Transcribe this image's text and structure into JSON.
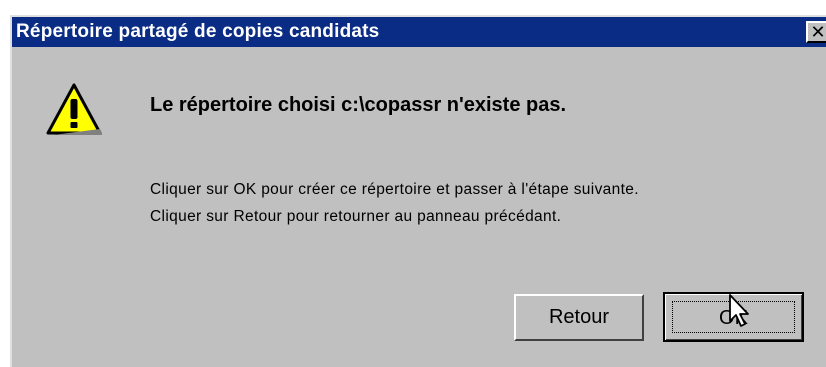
{
  "window": {
    "title": "Répertoire partagé de copies candidats",
    "close_glyph": "✕"
  },
  "message": {
    "heading": "Le répertoire choisi c:\\copassr n'existe pas.",
    "line1": "Cliquer sur OK pour créer ce répertoire et passer à l'étape suivante.",
    "line2": "Cliquer sur Retour pour retourner au panneau précédant."
  },
  "buttons": {
    "back_label": "Retour",
    "ok_label": "OK"
  },
  "icons": {
    "warning": "warning-icon",
    "close": "close-icon",
    "cursor": "mouse-pointer-icon"
  },
  "colors": {
    "titlebar": "#0a2c85",
    "dialog_bg": "#c0c0c0",
    "warning_fill": "#ffff00"
  }
}
